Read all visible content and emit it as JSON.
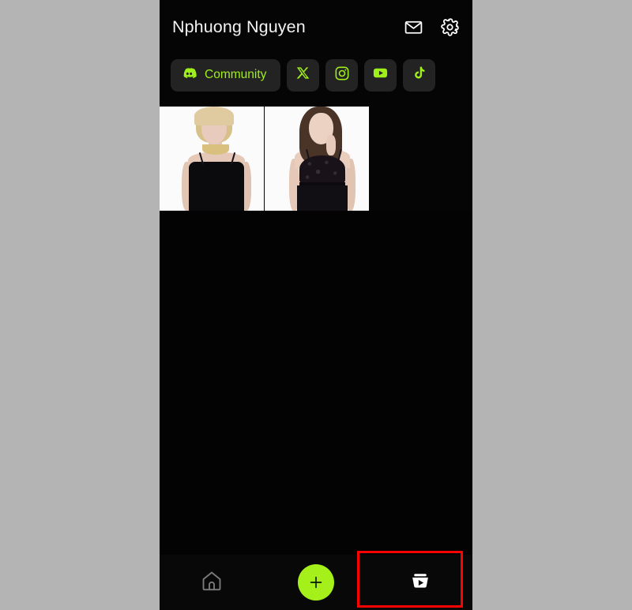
{
  "window": {
    "background_color": "#b4b4b4",
    "screen_background": "#050505"
  },
  "header": {
    "title": "Nphuong Nguyen",
    "actions": [
      {
        "name": "mail-icon",
        "label": "Inbox"
      },
      {
        "name": "gear-icon",
        "label": "Settings"
      }
    ]
  },
  "social_row": {
    "accent_color": "#9fef1a",
    "chip_background": "#232323",
    "items": [
      {
        "icon": "discord-icon",
        "label": "Community",
        "has_label": true
      },
      {
        "icon": "x-twitter-icon",
        "label": "X",
        "has_label": false
      },
      {
        "icon": "instagram-icon",
        "label": "Instagram",
        "has_label": false
      },
      {
        "icon": "youtube-icon",
        "label": "YouTube",
        "has_label": false
      },
      {
        "icon": "tiktok-icon",
        "label": "TikTok",
        "has_label": false
      }
    ]
  },
  "gallery": {
    "thumbnails": [
      {
        "name": "thumbnail-1",
        "alt": "Woman in black velvet dress with gold necklace"
      },
      {
        "name": "thumbnail-2",
        "alt": "Woman in black lace dress"
      }
    ]
  },
  "bottom_nav": {
    "items": [
      {
        "name": "home-icon",
        "label": "Home",
        "style": "outline"
      },
      {
        "name": "add-icon",
        "label": "Create",
        "style": "fab",
        "color": "#a5f01a"
      },
      {
        "name": "video-library-icon",
        "label": "My videos",
        "style": "filled"
      }
    ]
  },
  "annotation": {
    "name": "highlight-rectangle",
    "color": "#fc0303",
    "target": "video-library-icon"
  }
}
